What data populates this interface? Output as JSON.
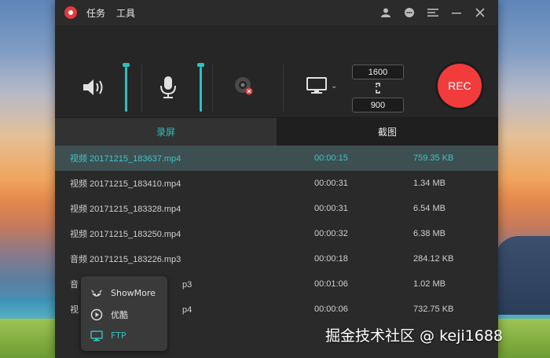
{
  "titlebar": {
    "menu": [
      "任务",
      "工具"
    ],
    "icons": [
      "user-icon",
      "chat-icon",
      "menu-icon",
      "minimize-icon",
      "close-icon"
    ]
  },
  "controls": {
    "speaker_volume": 1.0,
    "mic_volume": 1.0,
    "resolution": {
      "width_label": "1600",
      "height_label": "900"
    },
    "rec_label": "REC",
    "accent": "#2dc0c0",
    "rec_color": "#f23b3b"
  },
  "tabs": [
    {
      "label": "录屏",
      "active": true
    },
    {
      "label": "截图",
      "active": false
    }
  ],
  "files": [
    {
      "name": "视频 20171215_183637.mp4",
      "duration": "00:00:15",
      "size": "759.35 KB",
      "selected": true
    },
    {
      "name": "视频 20171215_183410.mp4",
      "duration": "00:00:31",
      "size": "1.34 MB"
    },
    {
      "name": "视频 20171215_183328.mp4",
      "duration": "00:00:31",
      "size": "6.54 MB"
    },
    {
      "name": "视频 20171215_183250.mp4",
      "duration": "00:00:32",
      "size": "6.38 MB"
    },
    {
      "name": "音频 20171215_183226.mp3",
      "duration": "00:00:18",
      "size": "284.12 KB"
    },
    {
      "name": "音",
      "tail": "p3",
      "duration": "00:01:06",
      "size": "1.02 MB"
    },
    {
      "name": "视",
      "tail": "p4",
      "duration": "00:00:06",
      "size": "732.75 KB"
    }
  ],
  "popup": [
    {
      "label": "ShowMore",
      "icon": "showmore-icon"
    },
    {
      "label": "优酷",
      "icon": "youku-icon"
    },
    {
      "label": "FTP",
      "icon": "ftp-icon"
    }
  ],
  "watermark": "掘金技术社区 @ keji1688"
}
